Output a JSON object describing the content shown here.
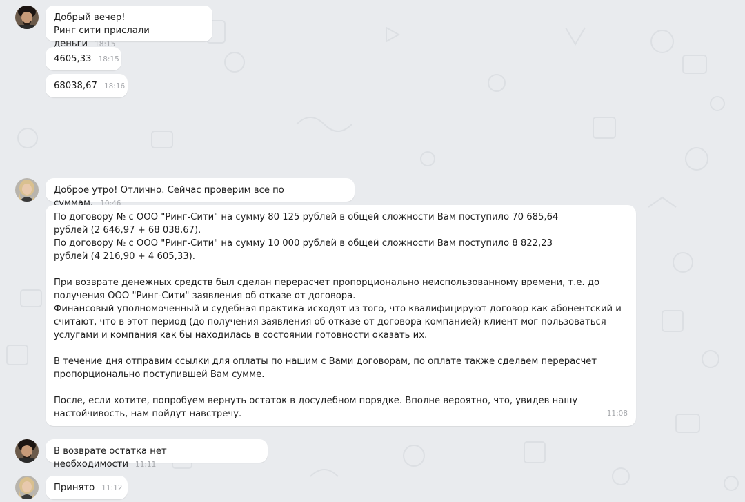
{
  "chat": {
    "messages": [
      {
        "sender": "client",
        "lines": [
          "Добрый вечер!",
          "Ринг сити прислали деньги"
        ],
        "time": "18:15"
      },
      {
        "sender": "client",
        "lines": [
          "4605,33"
        ],
        "time": "18:15"
      },
      {
        "sender": "client",
        "lines": [
          "68038,67"
        ],
        "time": "18:16"
      },
      {
        "sender": "agent",
        "lines": [
          "Доброе утро! Отлично. Сейчас проверим все по суммам."
        ],
        "time": "10:46"
      },
      {
        "sender": "agent",
        "paragraphs": [
          "По договору №                          с ООО \"Ринг-Сити\" на сумму 80 125 рублей в общей сложности Вам поступило 70 685,64\nрублей (2 646,97 + 68 038,67).\nПо договору №                          с ООО \"Ринг-Сити\" на сумму 10 000 рублей в общей сложности Вам поступило 8 822,23\nрублей (4 216,90 + 4 605,33).",
          "При возврате денежных средств был сделан перерасчет пропорционально неиспользованному времени, т.е. до\nполучения ООО \"Ринг-Сити\" заявления об отказе от договора.\nФинансовый уполномоченный и судебная практика исходят из того, что квалифицируют договор как абонентский и\nсчитают, что в этот период (до получения заявления об отказе от договора компанией) клиент мог пользоваться\nуслугами и компания как бы находилась в состоянии готовности оказать их.",
          "В течение дня отправим ссылки для оплаты по нашим с Вами договорам, по оплате также сделаем перерасчет\nпропорционально поступившей Вам сумме.",
          "После, если хотите, попробуем вернуть остаток в досудебном порядке. Вполне вероятно, что, увидев нашу\nнастойчивость, нам пойдут навстречу."
        ],
        "time": "11:08"
      },
      {
        "sender": "client",
        "lines": [
          "В возврате остатка нет необходимости"
        ],
        "time": "11:11"
      },
      {
        "sender": "agent",
        "lines": [
          "Принято"
        ],
        "time": "11:12"
      }
    ]
  },
  "colors": {
    "background": "#e9ebee",
    "bubble": "#ffffff",
    "timestamp": "#a7a9ad"
  },
  "icons": {
    "client_avatar": "avatar-man-dark-hair",
    "agent_avatar": "avatar-woman-blonde"
  }
}
